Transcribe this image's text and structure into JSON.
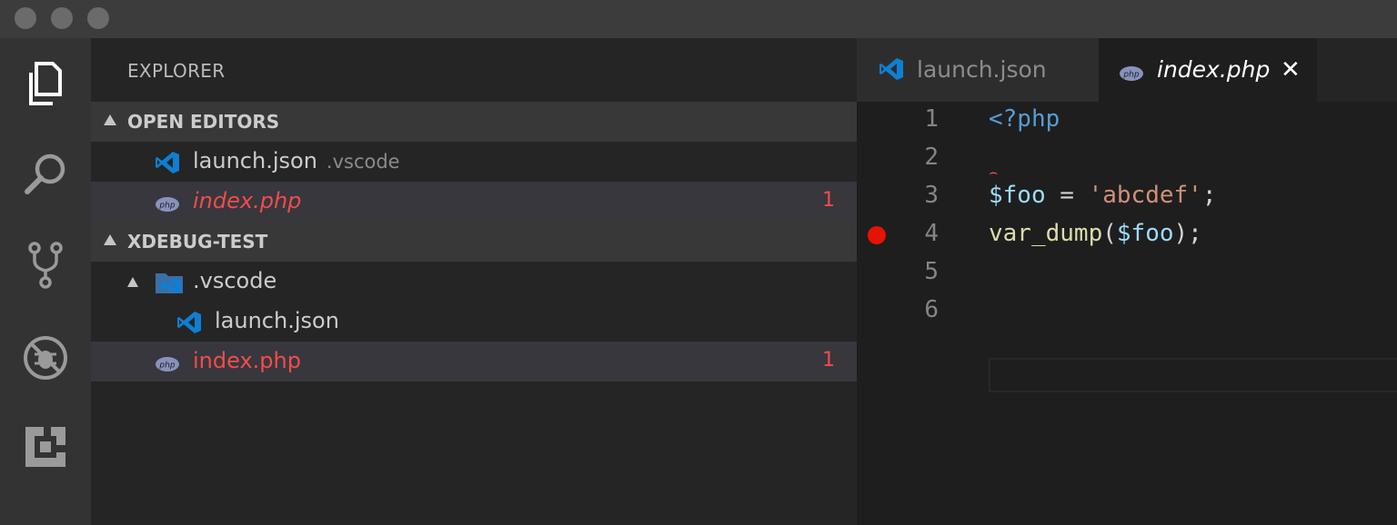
{
  "explorer": {
    "title": "EXPLORER",
    "open_editors": {
      "heading": "OPEN EDITORS",
      "items": [
        {
          "name": "launch.json",
          "desc": ".vscode",
          "icon": "vscode-icon"
        },
        {
          "name": "index.php",
          "count": "1",
          "icon": "php-icon"
        }
      ]
    },
    "project": {
      "heading": "XDEBUG-TEST",
      "folder": ".vscode",
      "folder_child": "launch.json",
      "file": "index.php",
      "file_count": "1"
    }
  },
  "tabs": [
    {
      "label": "launch.json",
      "icon": "vscode-icon"
    },
    {
      "label": "index.php",
      "icon": "php-icon",
      "close": "✕"
    }
  ],
  "code": {
    "line_numbers": [
      "1",
      "2",
      "3",
      "4",
      "5",
      "6"
    ],
    "l1_kw": "<?php",
    "l3_var": "$foo",
    "l3_eq": " = ",
    "l3_str": "'abcdef'",
    "l3_end": ";",
    "l4_fn": "var_dump",
    "l4_open": "(",
    "l4_var": "$foo",
    "l4_close": ");",
    "squiggle": "⌢"
  },
  "colors": {
    "error": "#f14c4c",
    "breakpoint": "#e51400",
    "accent": "#0e7fd4"
  }
}
